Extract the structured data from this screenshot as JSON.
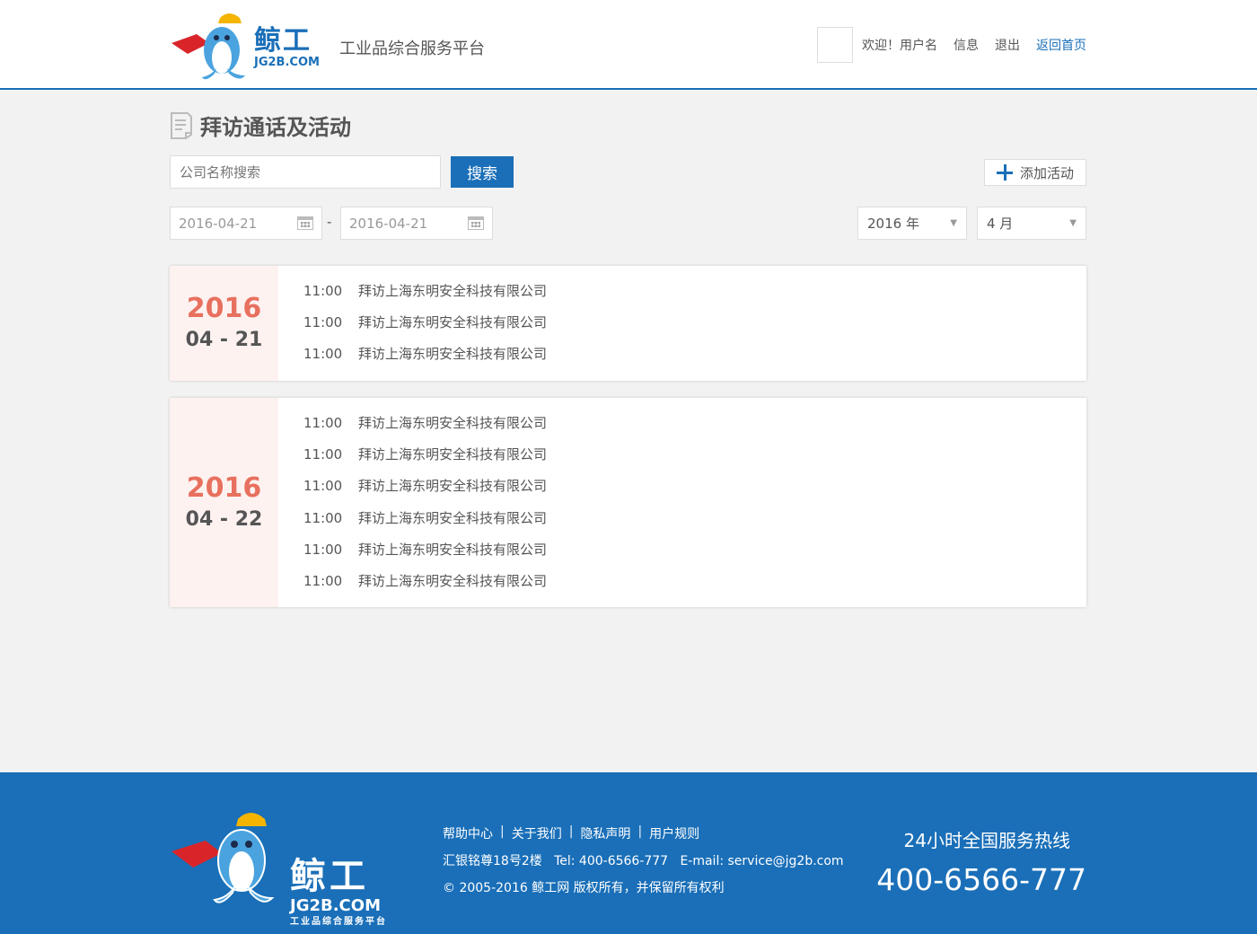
{
  "header": {
    "logo_cn": "鲸工",
    "logo_en": "JG2B.COM",
    "slogan": "工业品综合服务平台",
    "welcome": "欢迎！用户名",
    "info_link": "信息",
    "logout_link": "退出",
    "home_link": "返回首页"
  },
  "page": {
    "title": "拜访通话及活动",
    "search_placeholder": "公司名称搜索",
    "search_button": "搜索",
    "add_button": "添加活动",
    "date_start": "2016-04-21",
    "date_separator": "-",
    "date_end": "2016-04-21",
    "year_select": "2016 年",
    "month_select": "4 月"
  },
  "days": [
    {
      "year": "2016",
      "month_day": "04 - 21",
      "items": [
        {
          "time": "11:00",
          "text": "拜访上海东明安全科技有限公司"
        },
        {
          "time": "11:00",
          "text": "拜访上海东明安全科技有限公司"
        },
        {
          "time": "11:00",
          "text": "拜访上海东明安全科技有限公司"
        }
      ]
    },
    {
      "year": "2016",
      "month_day": "04 - 22",
      "items": [
        {
          "time": "11:00",
          "text": "拜访上海东明安全科技有限公司"
        },
        {
          "time": "11:00",
          "text": "拜访上海东明安全科技有限公司"
        },
        {
          "time": "11:00",
          "text": "拜访上海东明安全科技有限公司"
        },
        {
          "time": "11:00",
          "text": "拜访上海东明安全科技有限公司"
        },
        {
          "time": "11:00",
          "text": "拜访上海东明安全科技有限公司"
        },
        {
          "time": "11:00",
          "text": "拜访上海东明安全科技有限公司"
        }
      ]
    }
  ],
  "footer": {
    "logo_cn": "鲸工",
    "logo_en": "JG2B.COM",
    "logo_sub": "工业品综合服务平台",
    "links": [
      "帮助中心",
      "关于我们",
      "隐私声明",
      "用户规则"
    ],
    "link_separator": "|",
    "address": "汇银铭尊18号2楼   Tel: 400-6566-777   E-mail: service@jg2b.com",
    "copyright": "© 2005-2016 鲸工网 版权所有，并保留所有权利",
    "hotline_label": "24小时全国服务热线",
    "hotline_number": "400-6566-777"
  },
  "colors": {
    "brand_blue": "#1a6fb8",
    "date_accent": "#e8705e",
    "date_panel_bg": "#fdf2f0"
  }
}
